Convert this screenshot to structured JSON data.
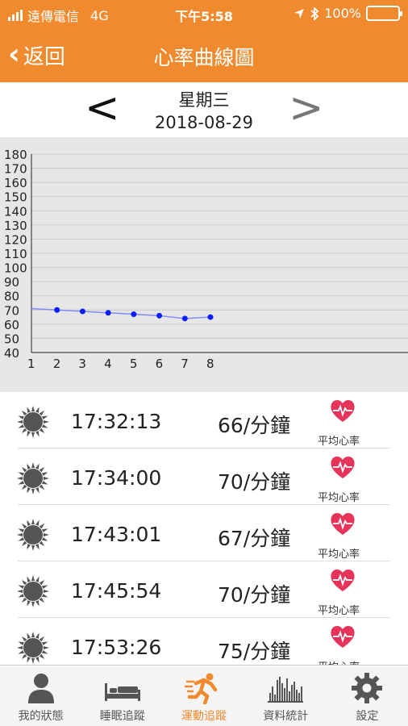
{
  "status_bar": {
    "carrier": "遠傳電信",
    "network": "4G",
    "time": "下午5:58",
    "battery": "100%",
    "battery_level": 1.0
  },
  "header": {
    "back_label": "返回",
    "title": "心率曲線圖"
  },
  "date_nav": {
    "prev": "<",
    "next": ">",
    "weekday": "星期三",
    "date": "2018-08-29"
  },
  "chart_data": {
    "type": "line",
    "x": [
      2,
      3,
      4,
      5,
      6,
      7,
      8
    ],
    "values": [
      70,
      69,
      68,
      67,
      66,
      64,
      65
    ],
    "line_start": {
      "x": 1,
      "y": 71
    },
    "xlim": [
      1,
      8
    ],
    "xticks": [
      "1",
      "2",
      "3",
      "4",
      "5",
      "6",
      "7",
      "8"
    ],
    "ylim": [
      40,
      180
    ],
    "yticks": [
      "40",
      "50",
      "60",
      "70",
      "80",
      "90",
      "100",
      "110",
      "120",
      "130",
      "140",
      "150",
      "160",
      "170",
      "180"
    ],
    "grid": true,
    "colors": {
      "line": "#7f8cf5",
      "point": "#0b1ff5",
      "background": "#e6e6e6"
    }
  },
  "records": [
    {
      "time": "17:32:13",
      "rate": "66/分鐘",
      "label": "平均心率"
    },
    {
      "time": "17:34:00",
      "rate": "70/分鐘",
      "label": "平均心率"
    },
    {
      "time": "17:43:01",
      "rate": "67/分鐘",
      "label": "平均心率"
    },
    {
      "time": "17:45:54",
      "rate": "70/分鐘",
      "label": "平均心率"
    },
    {
      "time": "17:53:26",
      "rate": "75/分鐘",
      "label": "平均心率"
    }
  ],
  "tabs": [
    {
      "label": "我的狀態",
      "icon": "person-icon",
      "active": false
    },
    {
      "label": "睡眠追蹤",
      "icon": "bed-icon",
      "active": false
    },
    {
      "label": "運動追蹤",
      "icon": "runner-icon",
      "active": true
    },
    {
      "label": "資料統計",
      "icon": "bar-stats-icon",
      "active": false
    },
    {
      "label": "設定",
      "icon": "gear-icon",
      "active": false
    }
  ],
  "colors": {
    "accent": "#f08a2e",
    "heart": "#e5335a",
    "icon_gray": "#555555"
  }
}
